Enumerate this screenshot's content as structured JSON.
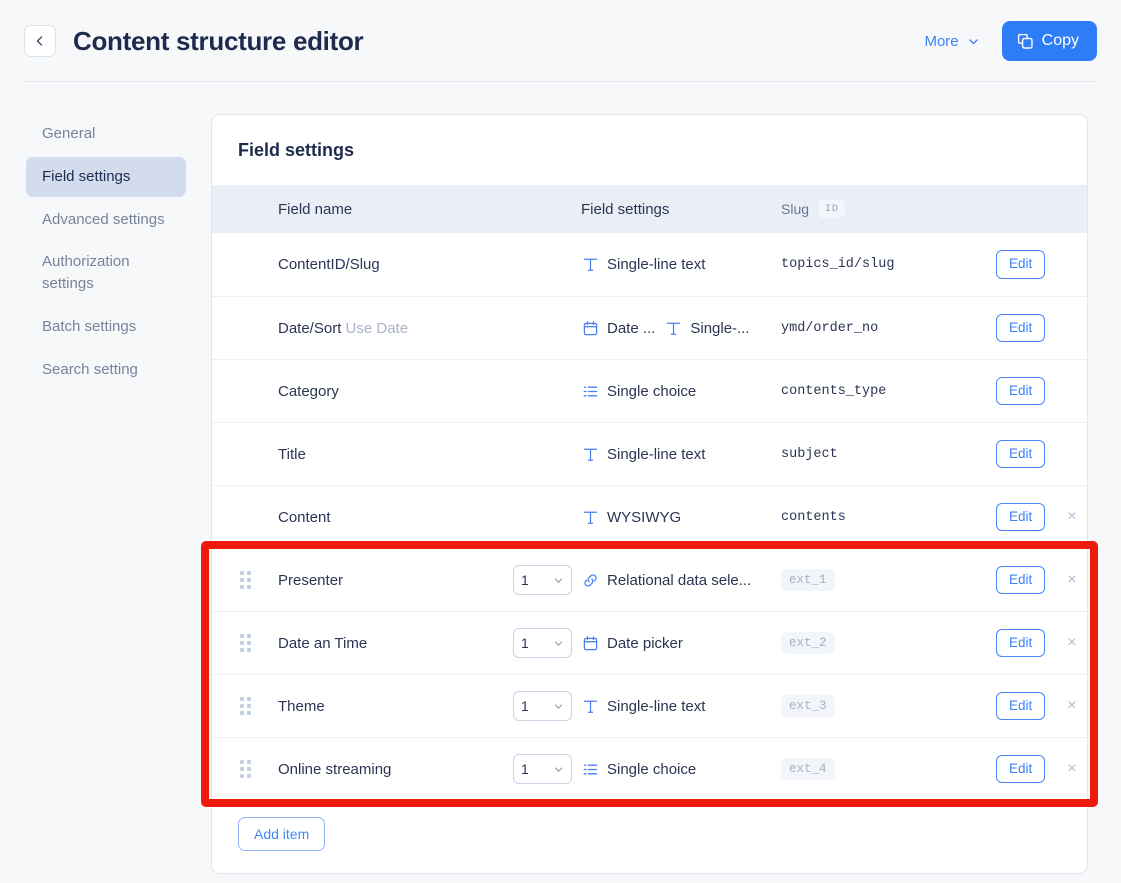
{
  "header": {
    "back_label": "←",
    "title": "Content structure editor",
    "more_label": "More",
    "copy_label": "Copy"
  },
  "sidebar": {
    "items": [
      {
        "label": "General",
        "active": false
      },
      {
        "label": "Field settings",
        "active": true
      },
      {
        "label": "Advanced settings",
        "active": false
      },
      {
        "label": "Authorization settings",
        "active": false
      },
      {
        "label": "Batch settings",
        "active": false
      },
      {
        "label": "Search setting",
        "active": false
      }
    ]
  },
  "card": {
    "title": "Field settings",
    "columns": {
      "field_name": "Field name",
      "field_settings": "Field settings",
      "slug": "Slug",
      "slug_badge": "ID"
    },
    "rows": [
      {
        "name": "ContentID/Slug",
        "name_muted": "",
        "has_handle": false,
        "count": "",
        "types": [
          {
            "icon": "text-icon",
            "label": "Single-line text"
          }
        ],
        "slug": "topics_id/slug",
        "slug_style": "plain",
        "edit_label": "Edit",
        "deletable": false
      },
      {
        "name": "Date/Sort",
        "name_muted": "Use Date",
        "has_handle": false,
        "count": "",
        "types": [
          {
            "icon": "calendar-icon",
            "label": "Date ..."
          },
          {
            "icon": "text-icon",
            "label": "Single-..."
          }
        ],
        "slug": "ymd/order_no",
        "slug_style": "plain",
        "edit_label": "Edit",
        "deletable": false
      },
      {
        "name": "Category",
        "name_muted": "",
        "has_handle": false,
        "count": "",
        "types": [
          {
            "icon": "list-icon",
            "label": "Single choice"
          }
        ],
        "slug": "contents_type",
        "slug_style": "plain",
        "edit_label": "Edit",
        "deletable": false
      },
      {
        "name": "Title",
        "name_muted": "",
        "has_handle": false,
        "count": "",
        "types": [
          {
            "icon": "text-icon",
            "label": "Single-line text"
          }
        ],
        "slug": "subject",
        "slug_style": "plain",
        "edit_label": "Edit",
        "deletable": false
      },
      {
        "name": "Content",
        "name_muted": "",
        "has_handle": false,
        "count": "",
        "types": [
          {
            "icon": "text-icon",
            "label": "WYSIWYG"
          }
        ],
        "slug": "contents",
        "slug_style": "plain",
        "edit_label": "Edit",
        "deletable": true,
        "delete_label": "×"
      },
      {
        "name": "Presenter",
        "name_muted": "",
        "has_handle": true,
        "count": "1",
        "types": [
          {
            "icon": "link-icon",
            "label": "Relational data sele..."
          }
        ],
        "slug": "ext_1",
        "slug_style": "chip",
        "edit_label": "Edit",
        "deletable": true,
        "delete_label": "×"
      },
      {
        "name": "Date an Time",
        "name_muted": "",
        "has_handle": true,
        "count": "1",
        "types": [
          {
            "icon": "calendar-icon",
            "label": "Date picker"
          }
        ],
        "slug": "ext_2",
        "slug_style": "chip",
        "edit_label": "Edit",
        "deletable": true,
        "delete_label": "×"
      },
      {
        "name": "Theme",
        "name_muted": "",
        "has_handle": true,
        "count": "1",
        "types": [
          {
            "icon": "text-icon",
            "label": "Single-line text"
          }
        ],
        "slug": "ext_3",
        "slug_style": "chip",
        "edit_label": "Edit",
        "deletable": true,
        "delete_label": "×"
      },
      {
        "name": "Online streaming",
        "name_muted": "",
        "has_handle": true,
        "count": "1",
        "types": [
          {
            "icon": "list-icon",
            "label": "Single choice"
          }
        ],
        "slug": "ext_4",
        "slug_style": "chip",
        "edit_label": "Edit",
        "deletable": true,
        "delete_label": "×"
      }
    ],
    "add_item_label": "Add item"
  },
  "annotation": {
    "highlight_color": "#ee1b0d",
    "covers_rows": [
      "Presenter",
      "Date an Time",
      "Theme",
      "Online streaming"
    ]
  },
  "colors": {
    "accent": "#2e7df6",
    "link": "#3b82f6",
    "page_bg": "#f7f8fa",
    "table_head_bg": "#eaeff7",
    "sidebar_active_bg": "#d2dced"
  }
}
